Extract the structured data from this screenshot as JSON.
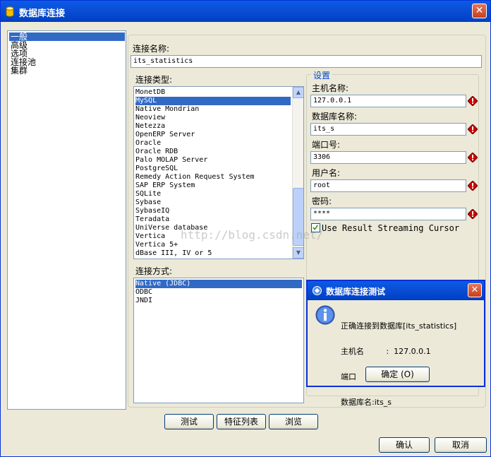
{
  "window": {
    "title": "数据库连接"
  },
  "nav": {
    "items": [
      "一般",
      "高级",
      "选项",
      "连接池",
      "集群"
    ],
    "selected": 0
  },
  "connection_name": {
    "label": "连接名称:",
    "value": "its_statistics"
  },
  "connection_type": {
    "label": "连接类型:",
    "items": [
      "MonetDB",
      "MySQL",
      "Native Mondrian",
      "Neoview",
      "Netezza",
      "OpenERP Server",
      "Oracle",
      "Oracle RDB",
      "Palo MOLAP Server",
      "PostgreSQL",
      "Remedy Action Request System",
      "SAP ERP System",
      "SQLite",
      "Sybase",
      "SybaseIQ",
      "Teradata",
      "UniVerse database",
      "Vertica",
      "Vertica 5+",
      "dBase III, IV or 5"
    ],
    "selected": 1
  },
  "access_method": {
    "label": "连接方式:",
    "items": [
      "Native (JDBC)",
      "ODBC",
      "JNDI"
    ],
    "selected": 0
  },
  "settings": {
    "legend": "设置",
    "host_label": "主机名称:",
    "host_value": "127.0.0.1",
    "db_label": "数据库名称:",
    "db_value": "its_s",
    "port_label": "端口号:",
    "port_value": "3306",
    "user_label": "用户名:",
    "user_value": "root",
    "password_label": "密码:",
    "password_value": "****",
    "streaming_label": "Use Result Streaming Cursor",
    "streaming_checked": true
  },
  "buttons": {
    "test": "测试",
    "features": "特征列表",
    "browse": "浏览",
    "ok": "确认",
    "cancel": "取消"
  },
  "watermark": "http://blog.csdn.net/",
  "dialog": {
    "title": "数据库连接测试",
    "line1": "正确连接到数据库[its_statistics]",
    "line2": "主机名         :  127.0.0.1",
    "line3": "端口           :  3306",
    "line4": "数据库名:its_s",
    "ok_label": "确定 (O)"
  },
  "colors": {
    "titlebar": "#0b4fd6",
    "selection": "#316ac5",
    "warning": "#cc0000",
    "legend": "#0046d5"
  },
  "icons": {
    "window": "database-icon",
    "warning": "warning-diamond-icon",
    "dialog_title": "gear-icon",
    "dialog_body": "info-icon"
  }
}
